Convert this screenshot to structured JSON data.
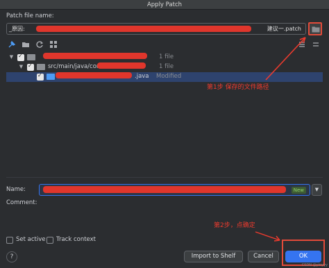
{
  "window": {
    "title": "Apply Patch"
  },
  "patch_file": {
    "label": "Patch file name:",
    "value_prefix": "_原因:",
    "value_suffix": "建议一.patch",
    "browse_icon": "folder-open-icon"
  },
  "toolbar": {
    "icons": [
      "pin-icon",
      "folder-group-icon",
      "refresh-icon",
      "grid-icon"
    ],
    "right_icons": [
      "expand-icon",
      "collapse-icon"
    ]
  },
  "tree": {
    "rows": [
      {
        "label": "",
        "meta": "1 file",
        "level": 0
      },
      {
        "label": "src/main/java/com/",
        "meta": "1 file",
        "level": 1
      },
      {
        "label": ".java",
        "meta": "Modified",
        "level": 2
      }
    ]
  },
  "changelist": {
    "name_label": "Name:",
    "name_value": "",
    "new_badge": "New",
    "comment_label": "Comment:"
  },
  "options": {
    "set_active": "Set active",
    "track_context": "Track context"
  },
  "buttons": {
    "help": "?",
    "import_to_shelf": "Import to Shelf",
    "cancel": "Cancel",
    "ok": "OK"
  },
  "annotations": {
    "step1": "第1步    保存的文件路径",
    "step2": "第2步，点确定"
  },
  "watermark": "CSDN @yinyyy"
}
